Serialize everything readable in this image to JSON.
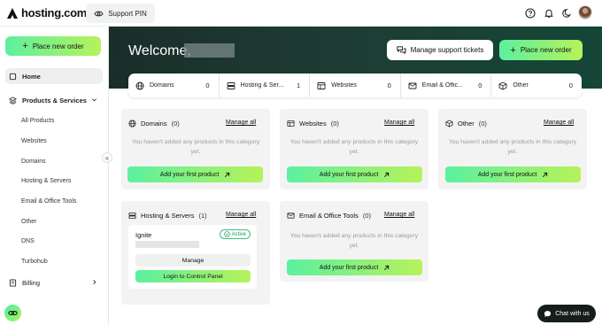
{
  "topbar": {
    "logo_text": "hosting.com",
    "support_pin_label": "Support PIN",
    "icons": [
      "help-icon",
      "bell-icon",
      "moon-icon"
    ]
  },
  "sidebar": {
    "place_order_label": "Place new order",
    "home_label": "Home",
    "products_services_label": "Products & Services",
    "sub_items": [
      "All Products",
      "Websites",
      "Domains",
      "Hosting & Servers",
      "Email & Office Tools",
      "Other",
      "DNS",
      "Turbohub"
    ],
    "billing_label": "Billing",
    "collapse_glyph": "«"
  },
  "hero": {
    "welcome": "Welcome,",
    "manage_tickets_label": "Manage support tickets",
    "place_order_label": "Place new order"
  },
  "stats": [
    {
      "label": "Domains",
      "count": "0",
      "icon": "globe-icon"
    },
    {
      "label": "Hosting & Ser...",
      "count": "1",
      "icon": "server-icon"
    },
    {
      "label": "Websites",
      "count": "0",
      "icon": "browser-icon"
    },
    {
      "label": "Email & Offic...",
      "count": "0",
      "icon": "mail-icon"
    },
    {
      "label": "Other",
      "count": "0",
      "icon": "box-icon"
    }
  ],
  "cards": {
    "domains": {
      "title": "Domains",
      "count": "(0)",
      "manage": "Manage all",
      "empty1": "You haven't added any products in this category",
      "empty2": "yet.",
      "add": "Add your first product"
    },
    "websites": {
      "title": "Websites",
      "count": "(0)",
      "manage": "Manage all",
      "empty1": "You haven't added any products in this category",
      "empty2": "yet.",
      "add": "Add your first product"
    },
    "other": {
      "title": "Other",
      "count": "(0)",
      "manage": "Manage all",
      "empty1": "You haven't added any products in this category",
      "empty2": "yet.",
      "add": "Add your first product"
    },
    "hosting": {
      "title": "Hosting & Servers",
      "count": "(1)",
      "manage": "Manage all",
      "product": {
        "name": "Ignite",
        "status": "Active",
        "manage_label": "Manage",
        "cp_label": "Login to Control Panel"
      }
    },
    "email": {
      "title": "Email & Office Tools",
      "count": "(0)",
      "manage": "Manage all",
      "empty1": "You haven't added any products in this category",
      "empty2": "yet.",
      "add": "Add your first product"
    }
  },
  "chat": {
    "label": "Chat with us"
  },
  "colors": {
    "accent_start": "#5cf0a0",
    "accent_end": "#b6f25a",
    "hero_bg": "#1e3c34",
    "active_green": "#1c9b5b"
  }
}
